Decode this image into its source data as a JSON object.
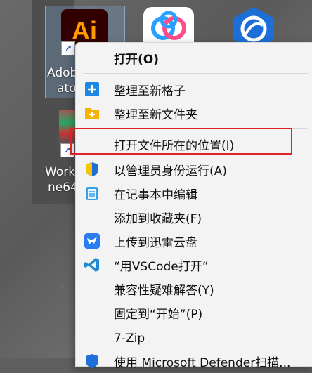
{
  "desktop": {
    "icons": [
      {
        "label_line1": "Adob",
        "label_line2": "ato"
      },
      {
        "label_line1": "Work",
        "label_line2": "ne64"
      }
    ],
    "ai_text": "Ai"
  },
  "menu": {
    "items": [
      {
        "label": "打开(O)",
        "icon": "none",
        "bold": true
      },
      {
        "label": "整理至新格子",
        "icon": "plus-blue-icon"
      },
      {
        "label": "整理至新文件夹",
        "icon": "plus-folder-icon"
      },
      {
        "label": "打开文件所在的位置(I)",
        "icon": "none",
        "highlighted": true
      },
      {
        "label": "以管理员身份运行(A)",
        "icon": "uac-shield-icon"
      },
      {
        "label": "在记事本中编辑",
        "icon": "notepad-icon"
      },
      {
        "label": "添加到收藏夹(F)",
        "icon": "none"
      },
      {
        "label": "上传到迅雷云盘",
        "icon": "xunlei-bird-icon"
      },
      {
        "label": "“用VSCode打开”",
        "icon": "vscode-icon"
      },
      {
        "label": "兼容性疑难解答(Y)",
        "icon": "none"
      },
      {
        "label": "固定到“开始”(P)",
        "icon": "none"
      },
      {
        "label": "7-Zip",
        "icon": "none"
      },
      {
        "label": "使用 Microsoft Defender扫描...",
        "icon": "defender-icon"
      }
    ]
  },
  "colors": {
    "menu_bg": "#f3f3f3",
    "highlight_border": "#e0202a",
    "accent_blue": "#1e6fd9"
  }
}
